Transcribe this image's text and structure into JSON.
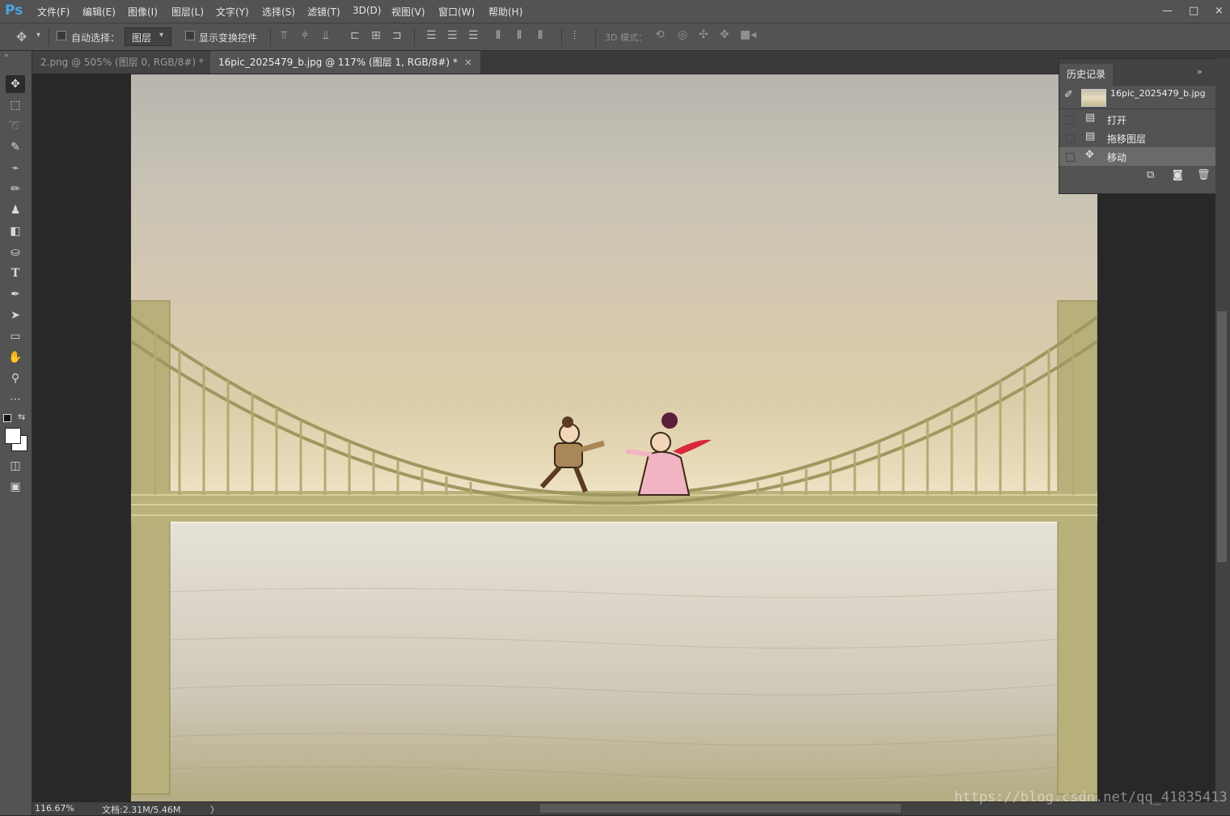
{
  "app": {
    "logo": "Ps"
  },
  "menu": [
    "文件(F)",
    "编辑(E)",
    "图像(I)",
    "图层(L)",
    "文字(Y)",
    "选择(S)",
    "滤镜(T)",
    "3D(D)",
    "视图(V)",
    "窗口(W)",
    "帮助(H)"
  ],
  "window_controls": {
    "minimize": "—",
    "maximize": "□",
    "close": "×"
  },
  "options": {
    "auto_select_label": "自动选择：",
    "auto_select_checked": false,
    "layer_select_value": "图层",
    "show_transform_label": "显示变换控件",
    "show_transform_checked": false,
    "mode_3d_label": "3D 模式："
  },
  "tabs": [
    {
      "label": "2.png @ 505% (图层 0, RGB/8#) *",
      "close": "×",
      "active": false
    },
    {
      "label": "16pic_2025479_b.jpg @ 117% (图层 1, RGB/8#) *",
      "close": "×",
      "active": true
    }
  ],
  "tools": [
    "move-tool-icon",
    "marquee-tool-icon",
    "lasso-tool-icon",
    "quick-select-tool-icon",
    "eyedropper-tool-icon",
    "brush-tool-icon",
    "stamp-tool-icon",
    "eraser-tool-icon",
    "bucket-tool-icon",
    "type-tool-icon",
    "pen-tool-icon",
    "path-select-tool-icon",
    "rectangle-tool-icon",
    "hand-tool-icon",
    "zoom-tool-icon",
    "more-tools-icon"
  ],
  "history": {
    "title": "历史记录",
    "snapshot": "16pic_2025479_b.jpg",
    "items": [
      {
        "label": "打开",
        "current": false
      },
      {
        "label": "拖移图层",
        "current": false
      },
      {
        "label": "移动",
        "current": true
      }
    ]
  },
  "status": {
    "zoom": "116.67%",
    "doc": "文档:2.31M/5.46M",
    "arrow": "〉"
  },
  "watermark": "https://blog.csdn.net/qq_41835413",
  "colors": {
    "accent": "#4ba3e3",
    "panel": "#535353",
    "dark": "#282828"
  }
}
